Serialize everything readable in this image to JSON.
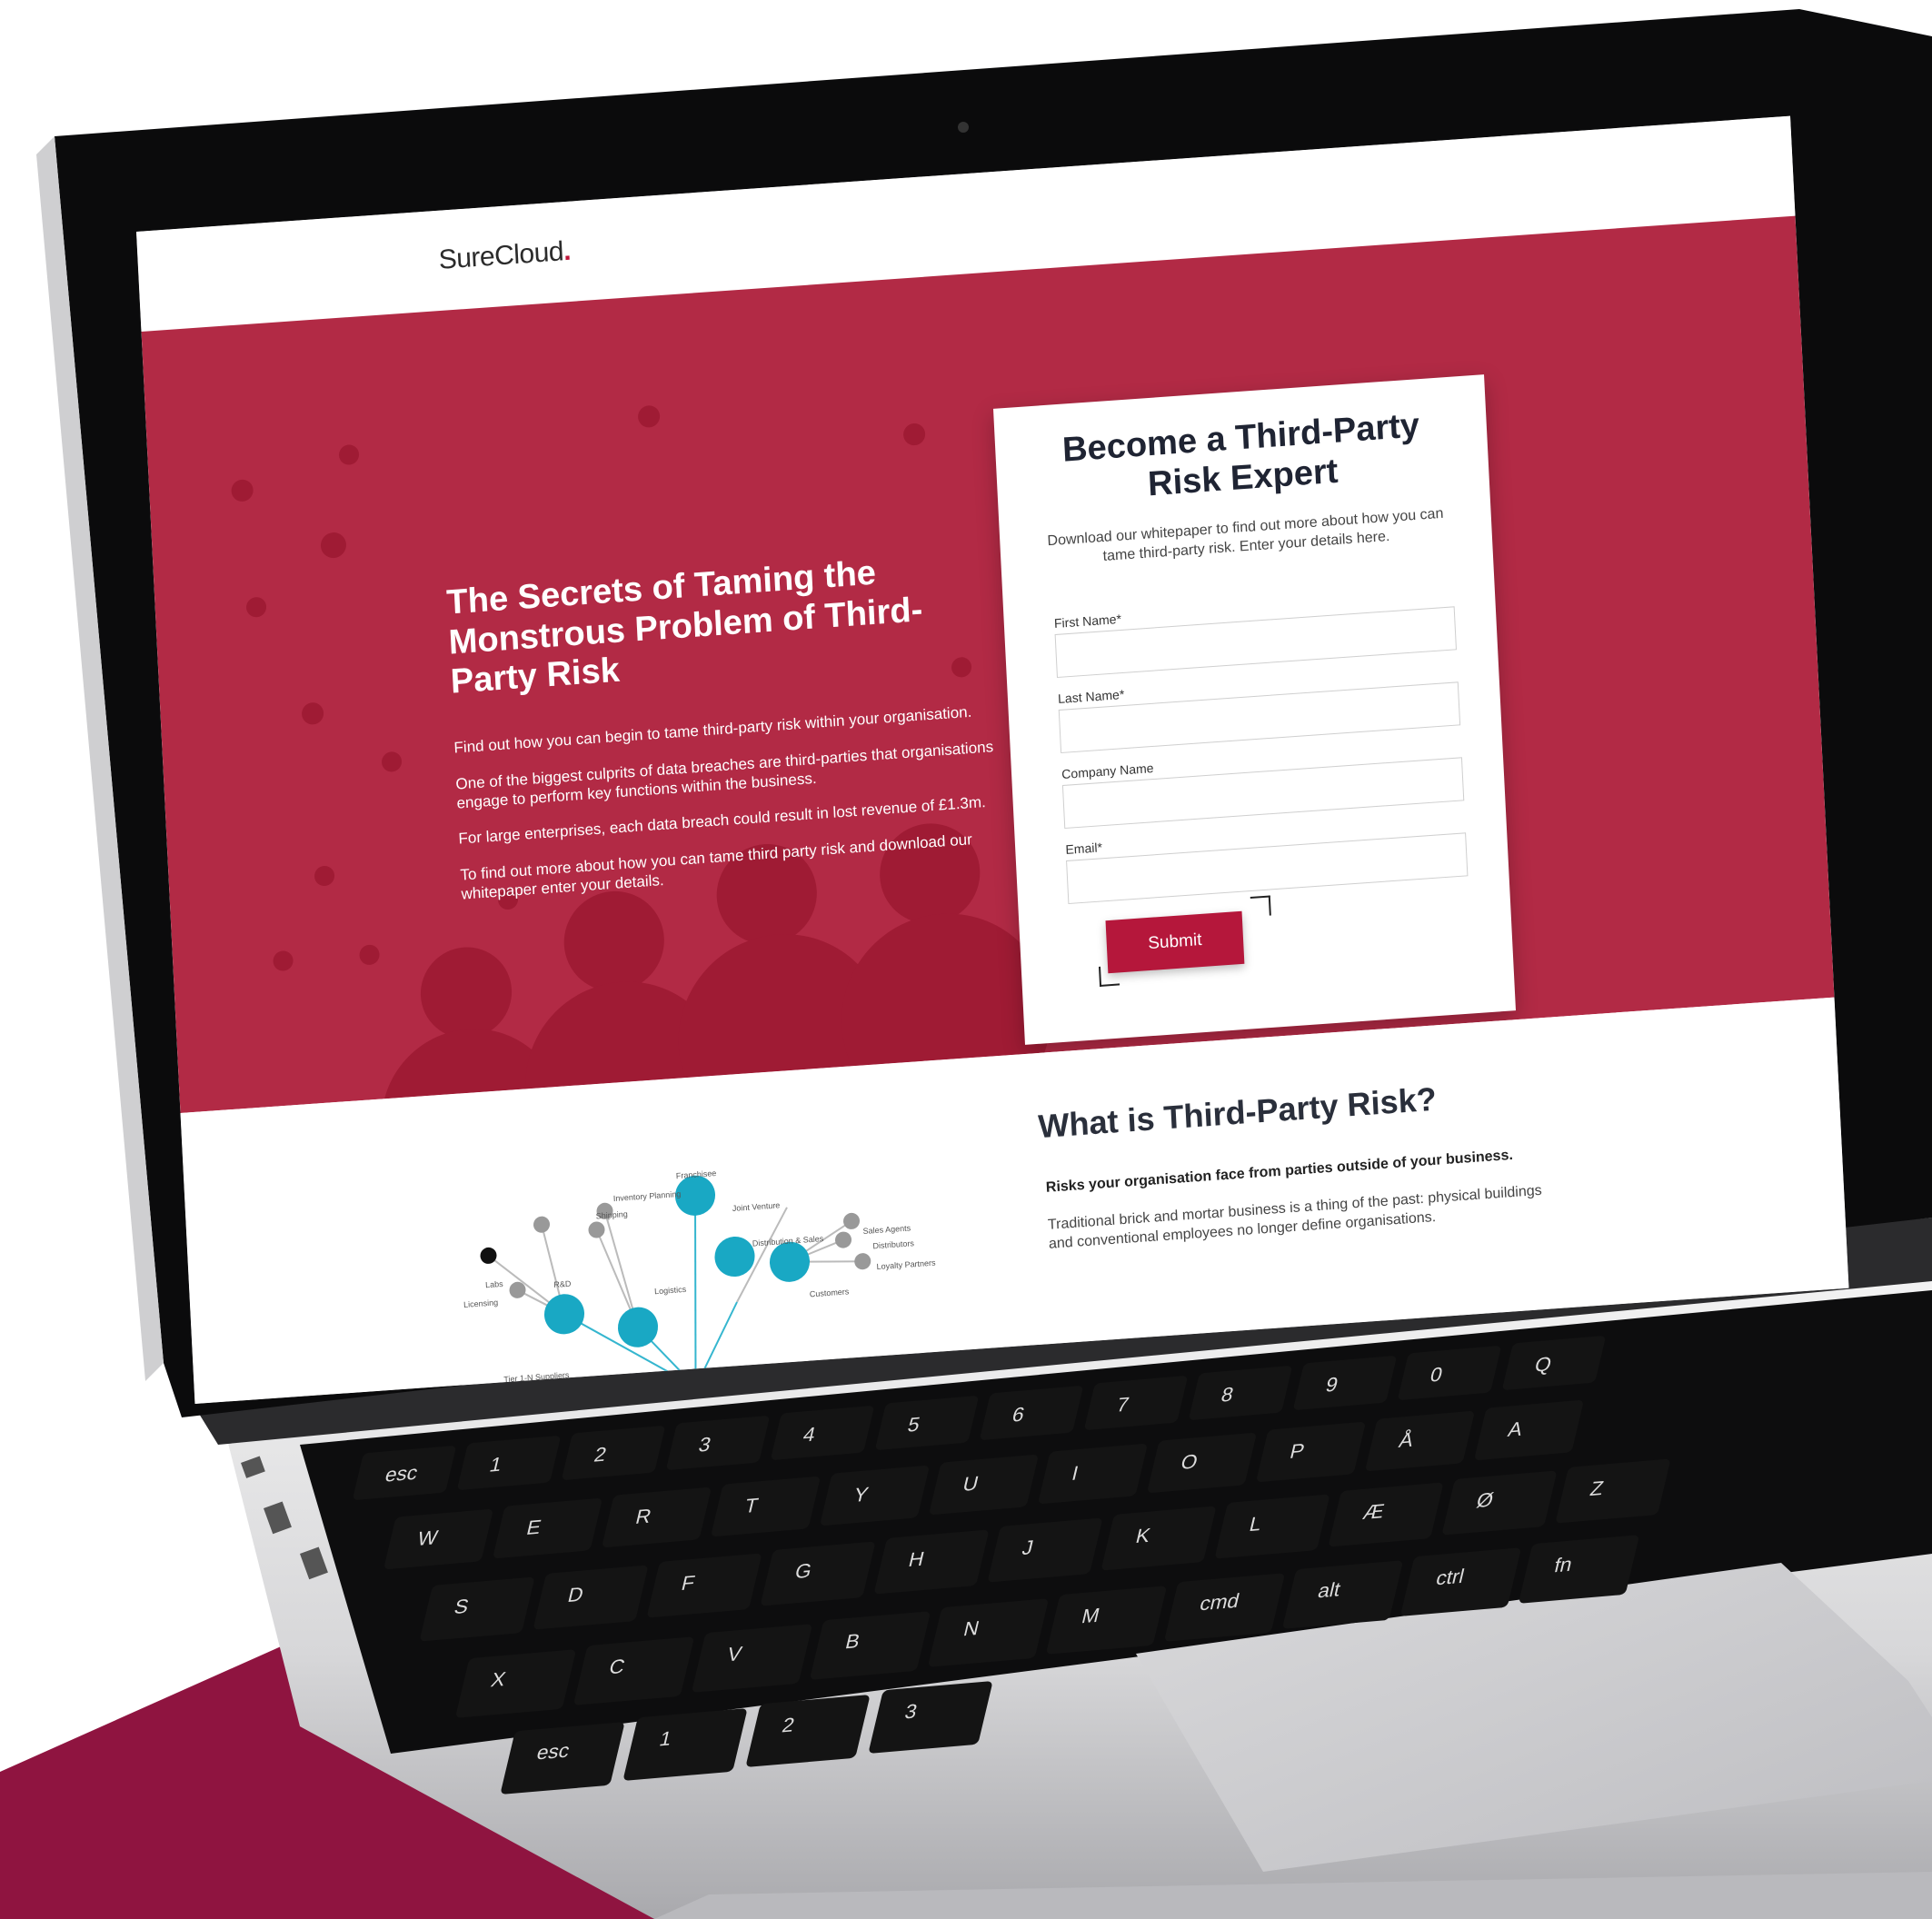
{
  "page": {
    "logo_text": "SureCloud",
    "logo_dot": "."
  },
  "hero": {
    "title": "The Secrets of Taming the Monstrous Problem of Third-Party Risk",
    "paragraphs": [
      "Find out how you can begin to tame third-party risk within your organisation.",
      "One of the biggest culprits of data breaches are third-parties that organisations engage to perform key functions within the business.",
      "For large enterprises, each data breach could result in lost revenue of £1.3m.",
      "To find out more about how you can tame third party risk and download our whitepaper enter your details."
    ]
  },
  "form": {
    "title": "Become a Third-Party Risk Expert",
    "subtitle": "Download our whitepaper to find out more about how you can tame third-party risk. Enter your details here.",
    "fields": [
      {
        "label": "First Name*",
        "value": ""
      },
      {
        "label": "Last Name*",
        "value": ""
      },
      {
        "label": "Company Name",
        "value": ""
      },
      {
        "label": "Email*",
        "value": ""
      }
    ],
    "submit_label": "Submit"
  },
  "section2": {
    "title": "What is Third-Party Risk?",
    "bold": "Risks your organisation face from parties outside of your business.",
    "paragraph": "Traditional brick and mortar business is a thing of the past: physical buildings and conventional employees no longer define organisations.",
    "diagram_labels": [
      "Inventory Planning",
      "Shipping",
      "Franchisee",
      "Joint Venture",
      "Sales Agents",
      "Distributors",
      "Loyalty Partners",
      "Customers",
      "R&D",
      "Labs",
      "Licensing",
      "Logistics",
      "Distribution & Sales",
      "Tier 1-N Suppliers"
    ]
  },
  "keyboard": {
    "keys": [
      "esc",
      "1",
      "2",
      "3",
      "4",
      "5",
      "6",
      "7",
      "8",
      "9",
      "0",
      "Q",
      "W",
      "E",
      "R",
      "T",
      "Y",
      "U",
      "I",
      "O",
      "P",
      "Å",
      "A",
      "S",
      "D",
      "F",
      "G",
      "H",
      "J",
      "K",
      "L",
      "Æ",
      "Ø",
      "Z",
      "X",
      "C",
      "V",
      "B",
      "N",
      "M",
      "cmd",
      "alt",
      "ctrl",
      "fn"
    ]
  },
  "colors": {
    "brand": "#b22a45",
    "brand_dark": "#8f1440",
    "button": "#b5173b",
    "text_dark": "#1f2433"
  }
}
